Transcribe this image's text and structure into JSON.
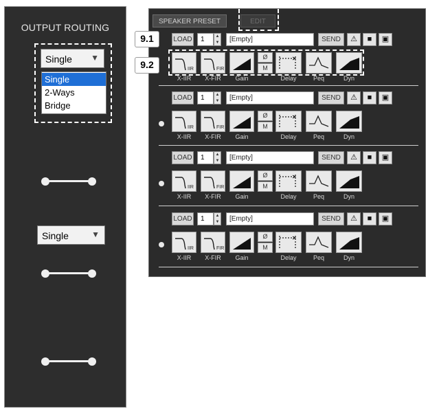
{
  "output_routing": {
    "title": "OUTPUT ROUTING",
    "select1": {
      "value": "Single",
      "options": [
        "Single",
        "2-Ways",
        "Bridge"
      ],
      "highlighted": "Single"
    },
    "select2": {
      "value": "Single"
    }
  },
  "speaker_preset": {
    "tabs": {
      "speaker_preset": "SPEAKER PRESET",
      "edit": "EDIT"
    },
    "callouts": {
      "c1": "9.1",
      "c2": "9.2"
    },
    "slots": [
      {
        "load": "LOAD",
        "number": "1",
        "name": "[Empty]",
        "send": "SEND"
      },
      {
        "load": "LOAD",
        "number": "1",
        "name": "[Empty]",
        "send": "SEND"
      },
      {
        "load": "LOAD",
        "number": "1",
        "name": "[Empty]",
        "send": "SEND"
      },
      {
        "load": "LOAD",
        "number": "1",
        "name": "[Empty]",
        "send": "SEND"
      }
    ],
    "block_labels": {
      "xiir": "X-IIR",
      "xfir": "X-FIR",
      "gain": "Gain",
      "delay": "Delay",
      "peq": "Peq",
      "dyn": "Dyn"
    },
    "phase_labels": {
      "top": "Ø",
      "bottom": "M"
    },
    "icons": {
      "warning": "warning-icon",
      "folder": "folder-icon",
      "save": "save-icon"
    }
  },
  "colors": {
    "panel_bg": "#2b2b2b",
    "highlight": "#1f6fd6",
    "button_bg": "#d8d8d8"
  }
}
